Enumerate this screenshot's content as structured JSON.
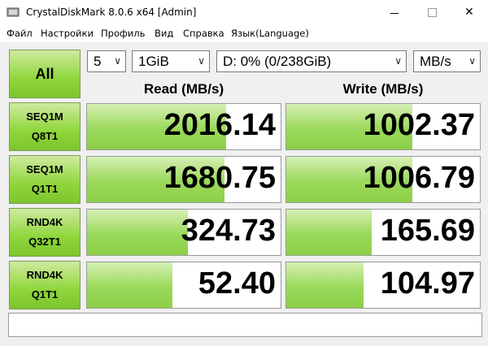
{
  "window": {
    "title": "CrystalDiskMark 8.0.6 x64 [Admin]",
    "controls": {
      "minimize": "—",
      "maximize": "☐",
      "close": "✕"
    }
  },
  "menu": [
    "Файл",
    "Настройки",
    "Профиль",
    "Вид",
    "Справка",
    "Язык(Language)"
  ],
  "controls": {
    "all_label": "All",
    "count": "5",
    "size": "1GiB",
    "drive": "D: 0% (0/238GiB)",
    "unit": "MB/s"
  },
  "headers": {
    "read": "Read (MB/s)",
    "write": "Write (MB/s)"
  },
  "tests": [
    {
      "line1": "SEQ1M",
      "line2": "Q8T1",
      "read": "2016.14",
      "write": "1002.37",
      "read_fill": 0.72,
      "write_fill": 0.65
    },
    {
      "line1": "SEQ1M",
      "line2": "Q1T1",
      "read": "1680.75",
      "write": "1006.79",
      "read_fill": 0.71,
      "write_fill": 0.65
    },
    {
      "line1": "RND4K",
      "line2": "Q32T1",
      "read": "324.73",
      "write": "165.69",
      "read_fill": 0.52,
      "write_fill": 0.44
    },
    {
      "line1": "RND4K",
      "line2": "Q1T1",
      "read": "52.40",
      "write": "104.97",
      "read_fill": 0.44,
      "write_fill": 0.4
    }
  ],
  "comment": "",
  "colors": {
    "accent_green": "#8fd63b",
    "bar_green": "#9ad95a"
  }
}
